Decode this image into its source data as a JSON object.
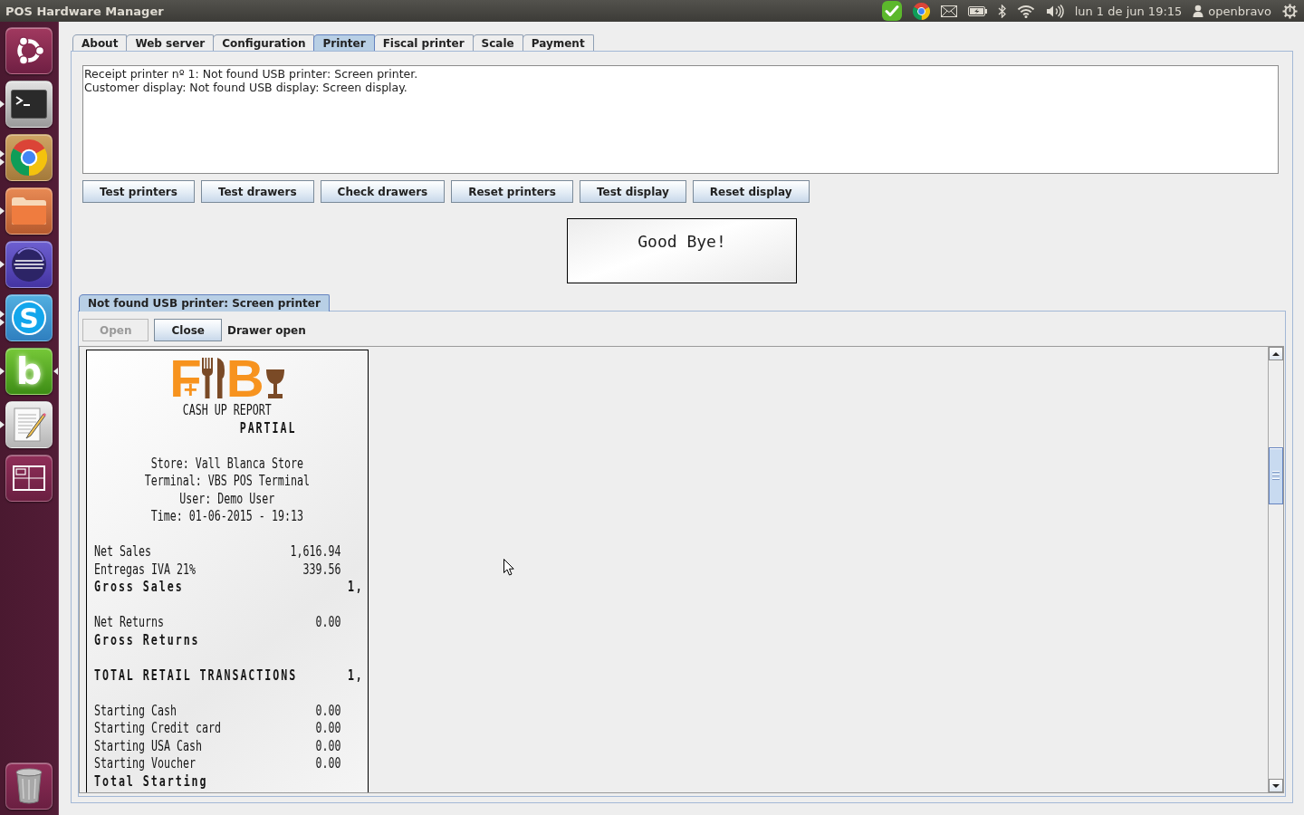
{
  "top_bar": {
    "title": "POS Hardware Manager",
    "clock": "lun 1 de jun 19:15",
    "user": "openbravo"
  },
  "launcher": [
    {
      "kind": "dash",
      "running": false,
      "multiple_windows": false,
      "focused": false
    },
    {
      "kind": "terminal",
      "running": true,
      "multiple_windows": false,
      "focused": false
    },
    {
      "kind": "browser",
      "running": true,
      "multiple_windows": true,
      "focused": false
    },
    {
      "kind": "files",
      "running": true,
      "multiple_windows": false,
      "focused": false
    },
    {
      "kind": "ide",
      "running": true,
      "multiple_windows": false,
      "focused": false
    },
    {
      "kind": "chat",
      "glyph": "S",
      "running": true,
      "multiple_windows": true,
      "focused": false
    },
    {
      "kind": "app",
      "glyph": "b",
      "running": true,
      "multiple_windows": false,
      "focused": true
    },
    {
      "kind": "editor",
      "running": true,
      "multiple_windows": false,
      "focused": false
    },
    {
      "kind": "workspaces",
      "running": false,
      "multiple_windows": false,
      "focused": false
    },
    {
      "kind": "trash",
      "running": false,
      "multiple_windows": false,
      "focused": false
    }
  ],
  "tabs": [
    {
      "label": "About",
      "selected": false
    },
    {
      "label": "Web server",
      "selected": false
    },
    {
      "label": "Configuration",
      "selected": false
    },
    {
      "label": "Printer",
      "selected": true
    },
    {
      "label": "Fiscal printer",
      "selected": false
    },
    {
      "label": "Scale",
      "selected": false
    },
    {
      "label": "Payment",
      "selected": false
    }
  ],
  "log": {
    "lines": [
      "Receipt printer nº 1: Not found USB printer: Screen printer.",
      "Customer display: Not found USB display: Screen display."
    ]
  },
  "buttons": [
    "Test printers",
    "Test drawers",
    "Check drawers",
    "Reset printers",
    "Test display",
    "Reset display"
  ],
  "display": {
    "lines": [
      "Good Bye!"
    ]
  },
  "printer_tabs": [
    {
      "label": "Not found USB printer: Screen printer",
      "selected": true
    }
  ],
  "drawer": {
    "buttons": [
      {
        "label": "Open",
        "disabled": true
      },
      {
        "label": "Close",
        "disabled": false
      }
    ],
    "status": "Drawer open"
  },
  "receipt": {
    "logo": {
      "text_1": "F$_{+}$",
      "text_2": "B"
    },
    "lines": [
      {
        "kind": "center",
        "text": "CASH UP REPORT"
      },
      {
        "kind": "title",
        "text": "PARTIAL"
      },
      {
        "kind": "blank"
      },
      {
        "kind": "center",
        "text": "Store: Vall Blanca Store"
      },
      {
        "kind": "center",
        "text": "Terminal: VBS POS Terminal"
      },
      {
        "kind": "center",
        "text": "User: Demo User"
      },
      {
        "kind": "center",
        "text": "Time: 01-06-2015 - 19:13"
      },
      {
        "kind": "blank"
      },
      {
        "kind": "row",
        "label": "Net Sales",
        "value": "1,616.94"
      },
      {
        "kind": "row",
        "label": "Entregas IVA 21%",
        "value": "339.56"
      },
      {
        "kind": "total",
        "label": "Gross Sales",
        "value": "1,"
      },
      {
        "kind": "blank"
      },
      {
        "kind": "row",
        "label": "Net Returns",
        "value": "0.00"
      },
      {
        "kind": "total",
        "label": "Gross Returns"
      },
      {
        "kind": "blank"
      },
      {
        "kind": "total",
        "label": "TOTAL RETAIL TRANSACTIONS",
        "value": "1,"
      },
      {
        "kind": "blank"
      },
      {
        "kind": "row",
        "label": "Starting Cash",
        "value": "0.00"
      },
      {
        "kind": "row",
        "label": "Starting Credit card",
        "value": "0.00"
      },
      {
        "kind": "row",
        "label": "Starting USA Cash",
        "value": "0.00"
      },
      {
        "kind": "row",
        "label": "Starting Voucher",
        "value": "0.00"
      },
      {
        "kind": "total",
        "label": "Total Starting"
      }
    ]
  }
}
